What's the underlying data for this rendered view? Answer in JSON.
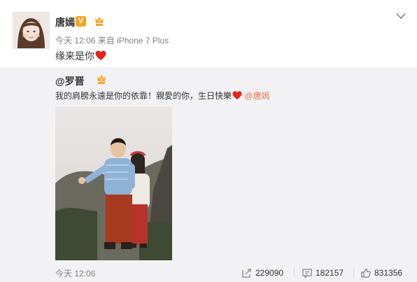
{
  "author": {
    "name": "唐嫣",
    "verified_badge": "V",
    "avatar_icon": "avatar-icon",
    "member_icon": "crown-member-icon"
  },
  "post": {
    "time": "今天 12:06",
    "source_prefix": "来自",
    "device": "iPhone 7 Plus",
    "text": "缘来是你",
    "emoji": "heart-icon"
  },
  "repost": {
    "author": "@罗晋",
    "text": "我的肩膀永遠是你的依靠！親愛的你，生日快樂",
    "mention": "@唐嫣",
    "time": "今天 12:06",
    "image_icon": "photo-image"
  },
  "actions": {
    "repost_count": "229090",
    "comment_count": "182157",
    "like_count": "831356"
  },
  "colors": {
    "accent": "#eb7350",
    "heart": "#e0241a",
    "repost_bg": "#f2f2f5",
    "meta_text": "#808080",
    "vip_orange": "#f5a623"
  }
}
